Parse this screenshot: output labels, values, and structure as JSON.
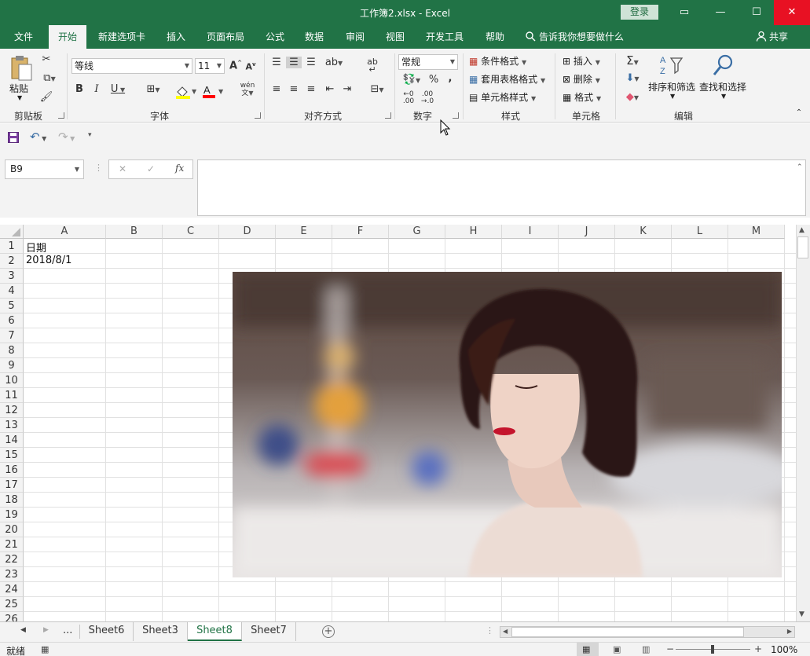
{
  "window": {
    "title": "工作簿2.xlsx  -  Excel",
    "login": "登录",
    "minimize_glyph": "—",
    "restore_glyph": "☐",
    "close_glyph": "✕",
    "ribbon_toggle_glyph": "▭"
  },
  "tabs": [
    "文件",
    "开始",
    "新建选项卡",
    "插入",
    "页面布局",
    "公式",
    "数据",
    "审阅",
    "视图",
    "开发工具",
    "帮助"
  ],
  "active_tab": "开始",
  "tell_me": "告诉我你想要做什么",
  "share": "共享",
  "ribbon": {
    "clipboard": {
      "paste": "粘贴",
      "label": "剪贴板"
    },
    "font": {
      "font_name": "等线",
      "font_size": "11",
      "grow": "A",
      "shrink": "A",
      "bold": "B",
      "italic": "I",
      "underline": "U",
      "fill_color": "#ffff00",
      "font_color": "#ff0000",
      "phonetic": "wén",
      "label": "字体"
    },
    "alignment": {
      "wrap": "ab",
      "label": "对齐方式"
    },
    "number": {
      "format": "常规",
      "percent": "%",
      "comma": ",",
      "label": "数字"
    },
    "styles": {
      "conditional": "条件格式",
      "table": "套用表格格式",
      "cell_styles": "单元格样式",
      "label": "样式"
    },
    "cells": {
      "insert": "插入",
      "delete": "删除",
      "format": "格式",
      "label": "单元格"
    },
    "editing": {
      "sort_filter": "排序和筛选",
      "find_select": "查找和选择",
      "label": "编辑"
    }
  },
  "formula_bar": {
    "name_box": "B9",
    "cancel_glyph": "✕",
    "enter_glyph": "✓",
    "fx": "fx",
    "formula": ""
  },
  "grid": {
    "columns": [
      "A",
      "B",
      "C",
      "D",
      "E",
      "F",
      "G",
      "H",
      "I",
      "J",
      "K",
      "L",
      "M"
    ],
    "rows": [
      "1",
      "2",
      "3",
      "4",
      "5",
      "6",
      "7",
      "8",
      "9",
      "10",
      "11",
      "12",
      "13",
      "14",
      "15",
      "16",
      "17",
      "18",
      "19",
      "20",
      "21",
      "22",
      "23",
      "24",
      "25",
      "26"
    ],
    "cells": {
      "A1": "日期",
      "A2": "2018/8/1"
    }
  },
  "sheet_tabs": {
    "ellipsis": "...",
    "tabs": [
      "Sheet6",
      "Sheet3",
      "Sheet8",
      "Sheet7"
    ],
    "active": "Sheet8",
    "add_glyph": "+"
  },
  "status": {
    "ready": "就绪",
    "zoom": "100%",
    "zoom_out": "−",
    "zoom_in": "+"
  }
}
